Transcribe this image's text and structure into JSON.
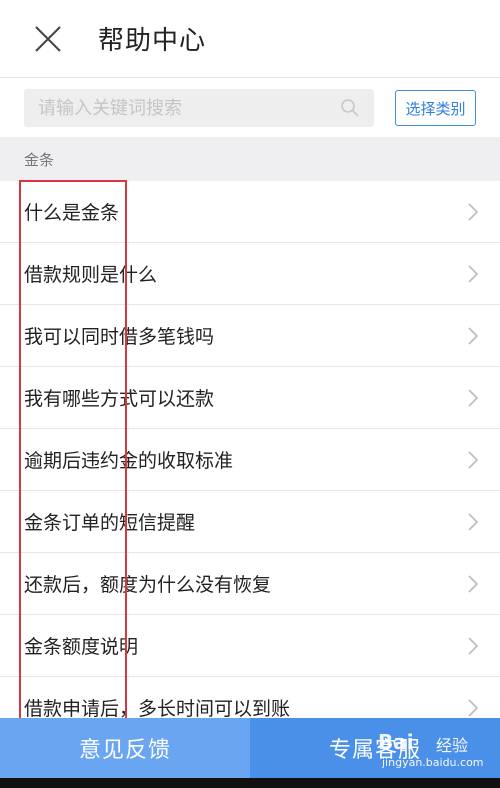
{
  "header": {
    "title": "帮助中心"
  },
  "search": {
    "placeholder": "请输入关键词搜索",
    "category_label": "选择类别"
  },
  "section": {
    "label": "金条"
  },
  "faq_items": [
    {
      "label": "什么是金条"
    },
    {
      "label": "借款规则是什么"
    },
    {
      "label": "我可以同时借多笔钱吗"
    },
    {
      "label": "我有哪些方式可以还款"
    },
    {
      "label": "逾期后违约金的收取标准"
    },
    {
      "label": "金条订单的短信提醒"
    },
    {
      "label": "还款后，额度为什么没有恢复"
    },
    {
      "label": "金条额度说明"
    },
    {
      "label": "借款申请后，多长时间可以到账"
    }
  ],
  "bottom": {
    "feedback_label": "意见反馈",
    "service_label": "专属客服"
  },
  "watermark": {
    "logo": "Bai",
    "label": "经验",
    "url": "jingyan.baidu.com"
  },
  "colors": {
    "accent": "#3a8ee6",
    "feedback_bg": "#6aa5f2",
    "service_bg": "#4a8fe8",
    "highlight": "#d9363e"
  }
}
